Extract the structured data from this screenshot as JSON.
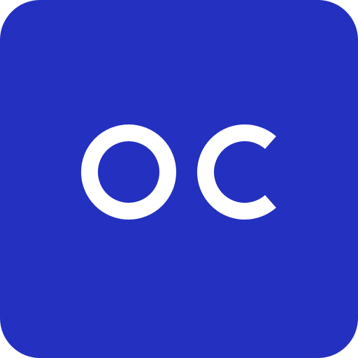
{
  "app_icon": {
    "icon_name": "oc-app-icon",
    "monogram": "OC",
    "background_color": "#2430BF",
    "foreground_color": "#FFFFFF"
  }
}
